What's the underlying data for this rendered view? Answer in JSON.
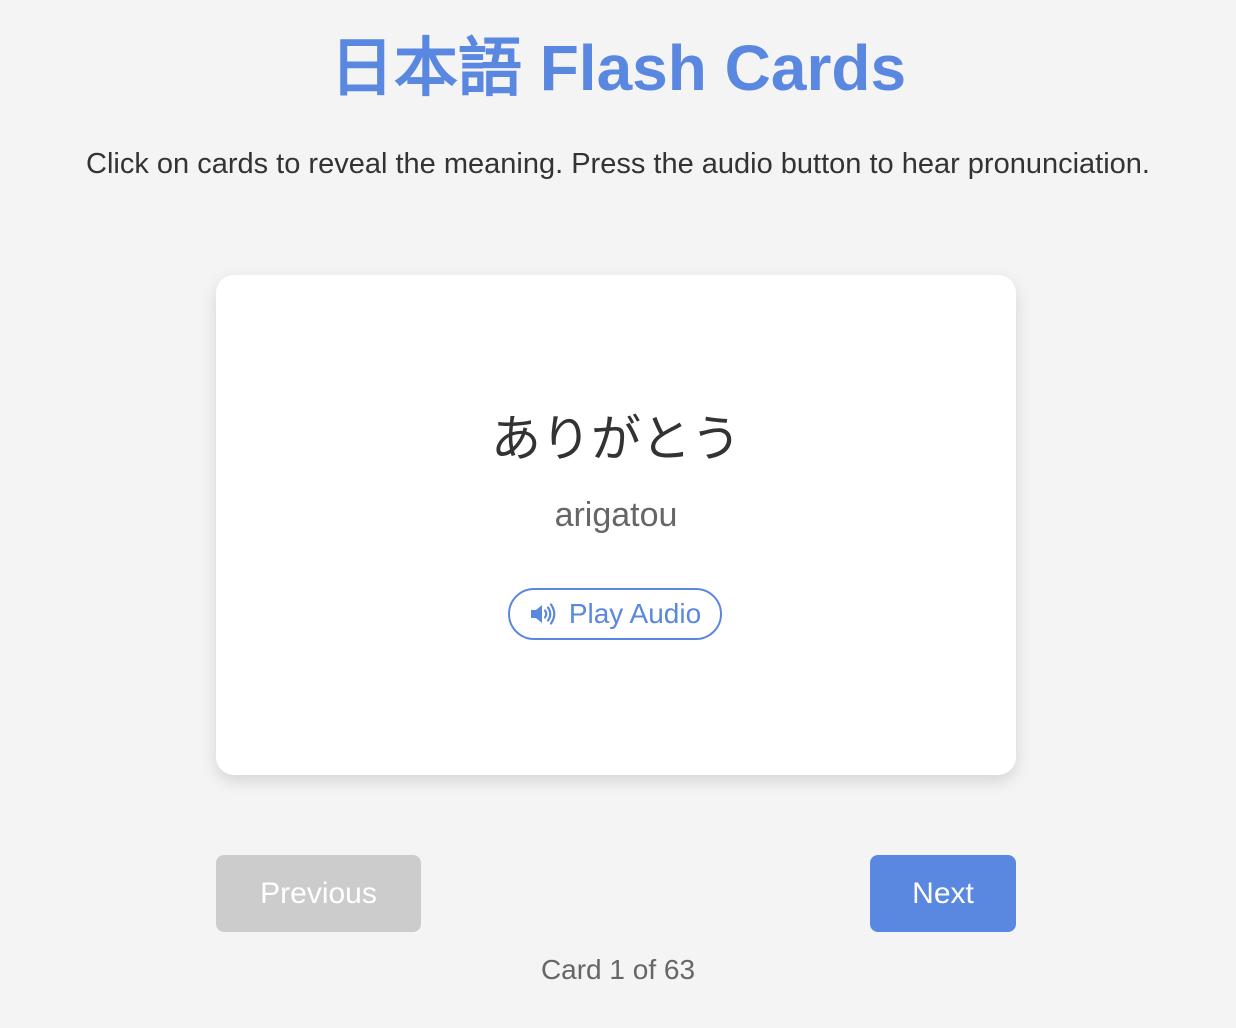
{
  "header": {
    "title": "日本語 Flash Cards",
    "instructions": "Click on cards to reveal the meaning. Press the audio button to hear pronunciation."
  },
  "card": {
    "japanese": "ありがとう",
    "romaji": "arigatou",
    "audio_button": {
      "icon": "speaker-icon",
      "label": "Play Audio"
    }
  },
  "navigation": {
    "previous_label": "Previous",
    "previous_disabled": true,
    "next_label": "Next",
    "counter": "Card 1 of 63"
  },
  "colors": {
    "accent": "#5a87e0",
    "background": "#f4f4f4",
    "disabled": "#cccccc",
    "card": "#ffffff"
  }
}
